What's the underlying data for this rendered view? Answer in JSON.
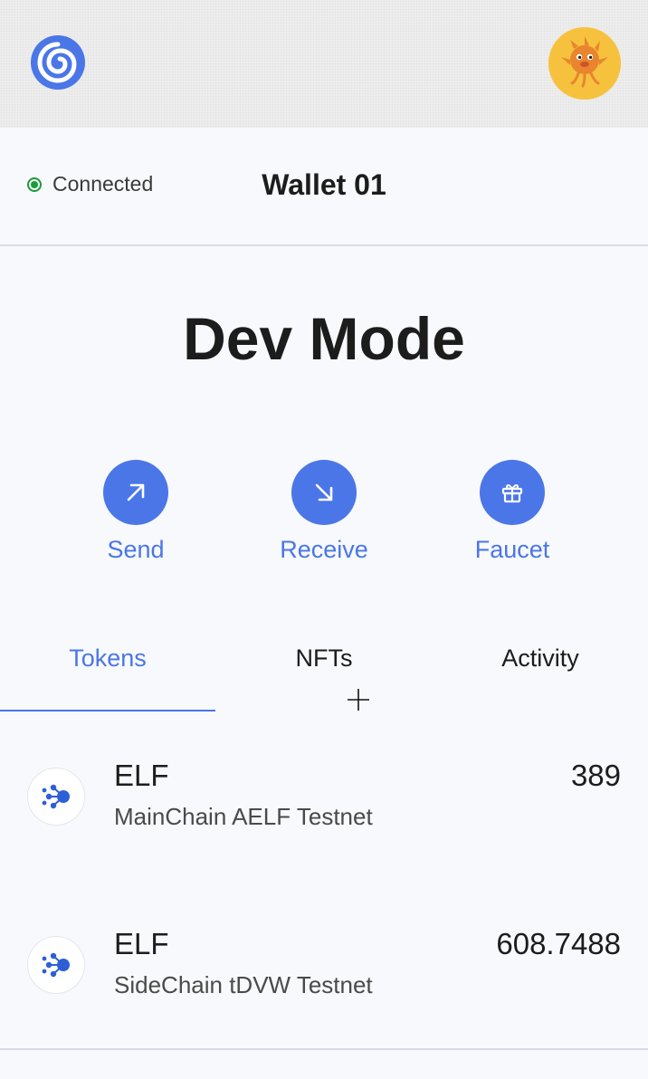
{
  "header": {
    "logo_icon": "swirl-logo-icon",
    "avatar_icon": "mascot-avatar-icon"
  },
  "wallet": {
    "status": "Connected",
    "status_color": "#1a9b3a",
    "name": "Wallet 01"
  },
  "balance": {
    "text": "Dev Mode"
  },
  "actions": [
    {
      "label": "Send",
      "icon": "arrow-up-right-icon"
    },
    {
      "label": "Receive",
      "icon": "arrow-down-right-icon"
    },
    {
      "label": "Faucet",
      "icon": "gift-icon"
    }
  ],
  "tabs": [
    {
      "label": "Tokens",
      "active": true
    },
    {
      "label": "NFTs",
      "active": false
    },
    {
      "label": "Activity",
      "active": false
    }
  ],
  "tokens": [
    {
      "symbol": "ELF",
      "chain": "MainChain AELF Testnet",
      "amount": "389",
      "icon": "elf-token-icon"
    },
    {
      "symbol": "ELF",
      "chain": "SideChain tDVW Testnet",
      "amount": "608.7488",
      "icon": "elf-token-icon"
    }
  ],
  "colors": {
    "accent": "#4b76e8",
    "background": "#f8f9fc",
    "token_icon": "#2d5fd6"
  }
}
